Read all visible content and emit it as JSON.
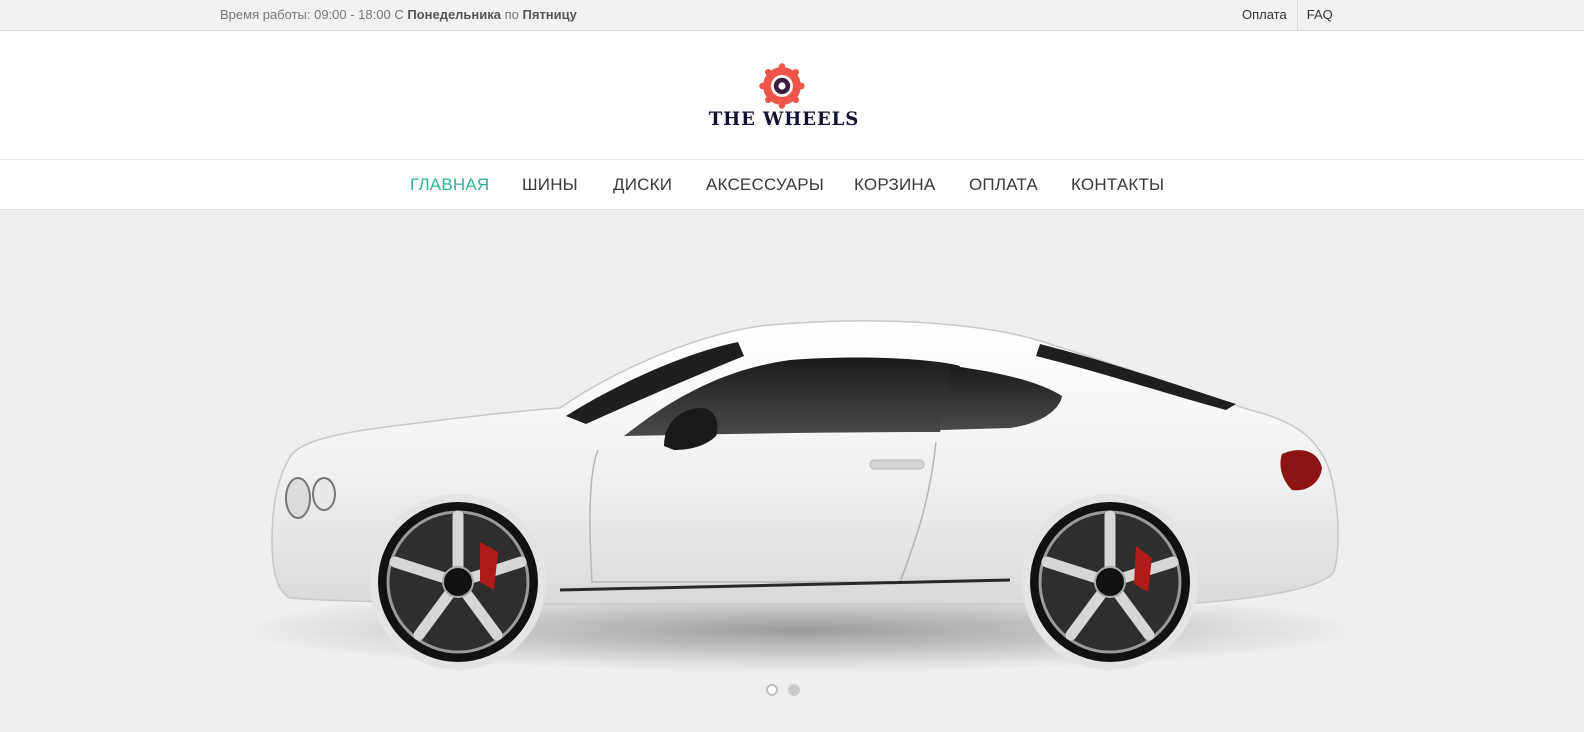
{
  "topbar": {
    "hours_prefix": "Время работы: 09:00 - 18:00 С ",
    "hours_from_day": "Понедельника",
    "hours_mid": " по ",
    "hours_to_day": "Пятницу",
    "links": [
      "Оплата",
      "FAQ"
    ]
  },
  "header": {
    "logo_text": "THE WHEELS",
    "logo_colors": {
      "ring": "#f0554a",
      "inner": "#3a1f3f",
      "text": "#111333"
    }
  },
  "nav": {
    "items": [
      "ГЛАВНАЯ",
      "ШИНЫ",
      "ДИСКИ",
      "АКСЕССУАРЫ",
      "КОРЗИНА",
      "ОПЛАТА",
      "КОНТАКТЫ"
    ],
    "active_color": "#2bb39a"
  },
  "slider": {
    "image": "white-coupe-car",
    "slide_count": 2,
    "active_slide": 1
  }
}
